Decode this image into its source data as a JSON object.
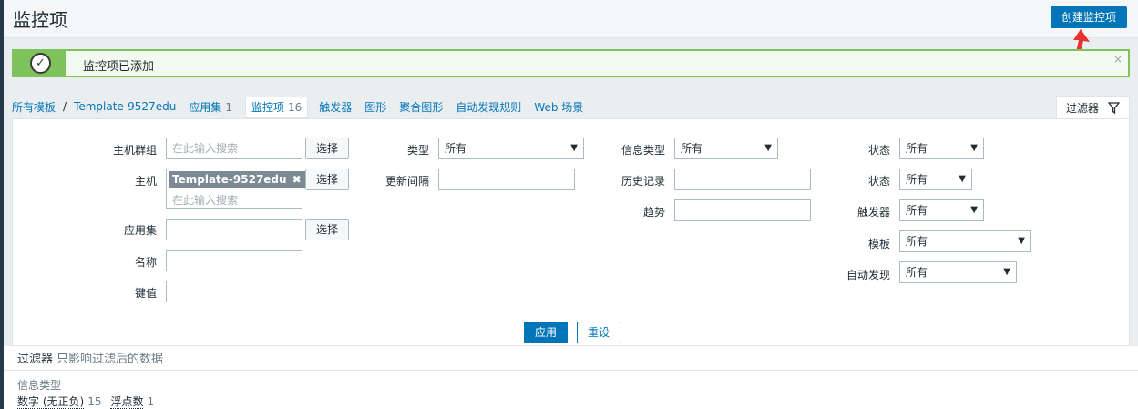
{
  "header": {
    "title": "监控项",
    "create_button": "创建监控项"
  },
  "message": {
    "text": "监控项已添加",
    "close": "×"
  },
  "nav": {
    "all_templates": "所有模板",
    "separator": "/",
    "template_name": "Template-9527edu",
    "tabs": [
      {
        "label": "应用集",
        "count": "1"
      },
      {
        "label": "监控项",
        "count": "16"
      },
      {
        "label": "触发器"
      },
      {
        "label": "图形"
      },
      {
        "label": "聚合图形"
      },
      {
        "label": "自动发现规则"
      },
      {
        "label": "Web 场景"
      }
    ]
  },
  "filter_tab": {
    "label": "过滤器",
    "icon": "funnel-icon"
  },
  "filter": {
    "host_group_label": "主机群组",
    "host_group_placeholder": "在此输入搜索",
    "select_button": "选择",
    "host_label": "主机",
    "host_chip": "Template-9527edu",
    "host_placeholder": "在此输入搜索",
    "application_label": "应用集",
    "name_label": "名称",
    "key_label": "键值",
    "type_label": "类型",
    "type_value": "所有",
    "update_interval_label": "更新间隔",
    "info_type_label": "信息类型",
    "info_type_value": "所有",
    "history_label": "历史记录",
    "trends_label": "趋势",
    "state_label": "状态",
    "state_value": "所有",
    "status_label": "状态",
    "status_value": "所有",
    "triggers_label": "触发器",
    "triggers_value": "所有",
    "template_label": "模板",
    "template_value": "所有",
    "discovery_label": "自动发现",
    "discovery_value": "所有",
    "apply_button": "应用",
    "reset_button": "重设"
  },
  "subfilter": {
    "title": "过滤器",
    "hint": "只影响过滤后的数据",
    "group_label": "信息类型",
    "items": [
      {
        "label": "数字 (无正负)",
        "count": "15"
      },
      {
        "label": "浮点数",
        "count": "1"
      }
    ]
  },
  "colors": {
    "accent": "#0275b8",
    "success": "#7dc25a",
    "annotation_arrow": "#e8312f"
  }
}
